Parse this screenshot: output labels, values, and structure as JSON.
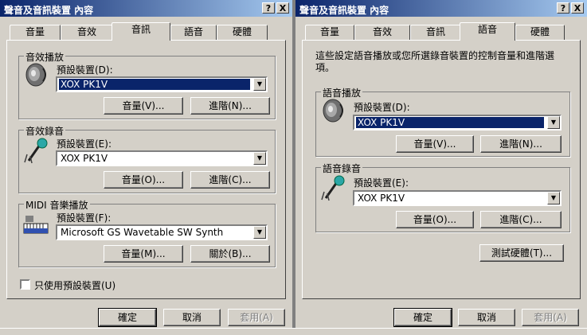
{
  "dialog1": {
    "title": "聲音及音訊裝置 內容",
    "tabs": [
      "音量",
      "音效",
      "音訊",
      "語音",
      "硬體"
    ],
    "active_tab": "音訊",
    "playback": {
      "title": "音效播放",
      "label": "預設裝置(D):",
      "device": "XOX PK1V",
      "volume_btn": "音量(V)...",
      "advanced_btn": "進階(N)..."
    },
    "recording": {
      "title": "音效錄音",
      "label": "預設裝置(E):",
      "device": "XOX PK1V",
      "volume_btn": "音量(O)...",
      "advanced_btn": "進階(C)..."
    },
    "midi": {
      "title": "MIDI 音樂播放",
      "label": "預設裝置(F):",
      "device": "Microsoft GS Wavetable SW Synth",
      "volume_btn": "音量(M)...",
      "about_btn": "關於(B)..."
    },
    "default_only": "只使用預設裝置(U)",
    "ok": "確定",
    "cancel": "取消",
    "apply": "套用(A)"
  },
  "dialog2": {
    "title": "聲音及音訊裝置 內容",
    "tabs": [
      "音量",
      "音效",
      "音訊",
      "語音",
      "硬體"
    ],
    "active_tab": "語音",
    "description": "這些設定語音播放或您所選錄音裝置的控制音量和進階選項。",
    "playback": {
      "title": "語音播放",
      "label": "預設裝置(D):",
      "device": "XOX PK1V",
      "volume_btn": "音量(V)...",
      "advanced_btn": "進階(N)..."
    },
    "recording": {
      "title": "語音錄音",
      "label": "預設裝置(E):",
      "device": "XOX PK1V",
      "volume_btn": "音量(O)...",
      "advanced_btn": "進階(C)..."
    },
    "test_btn": "測試硬體(T)...",
    "ok": "確定",
    "cancel": "取消",
    "apply": "套用(A)"
  },
  "titlebar_buttons": {
    "help": "?",
    "close": "X"
  },
  "icons": {
    "speaker": "speaker-icon",
    "microphone": "microphone-icon",
    "midi": "midi-keyboard-icon",
    "combo_arrow": "▼"
  }
}
